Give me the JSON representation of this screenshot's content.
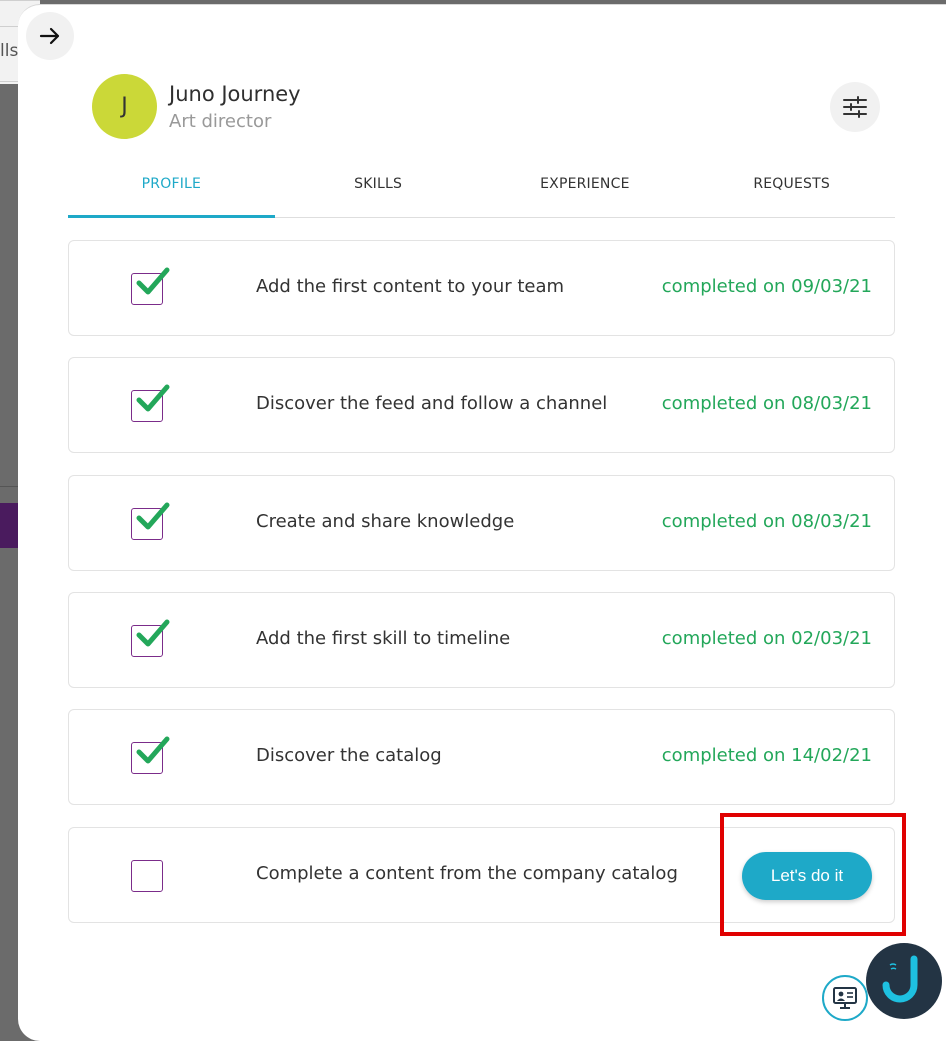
{
  "background": {
    "partial_text": "lls"
  },
  "header": {
    "back_icon": "arrow-right-icon",
    "avatar_initial": "J",
    "user_name": "Juno Journey",
    "user_role": "Art director",
    "settings_icon": "sliders-icon"
  },
  "tabs": [
    {
      "label": "PROFILE",
      "active": true
    },
    {
      "label": "SKILLS",
      "active": false
    },
    {
      "label": "EXPERIENCE",
      "active": false
    },
    {
      "label": "REQUESTS",
      "active": false
    }
  ],
  "tasks": [
    {
      "label": "Add the first content to your team",
      "checked": true,
      "status": "completed on 09/03/21"
    },
    {
      "label": "Discover the feed and follow a channel",
      "checked": true,
      "status": "completed on 08/03/21"
    },
    {
      "label": "Create and share knowledge",
      "checked": true,
      "status": "completed on 08/03/21"
    },
    {
      "label": "Add the first skill to timeline",
      "checked": true,
      "status": "completed on 02/03/21"
    },
    {
      "label": "Discover the catalog",
      "checked": true,
      "status": "completed on 14/02/21"
    },
    {
      "label": "Complete a content from the company catalog",
      "checked": false,
      "action": "Let's do it"
    }
  ],
  "colors": {
    "accent": "#1ea9c8",
    "completed": "#23a75a",
    "checkbox_border": "#7b2c8a",
    "highlight": "#e00000",
    "avatar": "#cbd838"
  },
  "floating": {
    "help_icon": "presentation-icon",
    "brand_icon": "juno-logo-icon"
  }
}
